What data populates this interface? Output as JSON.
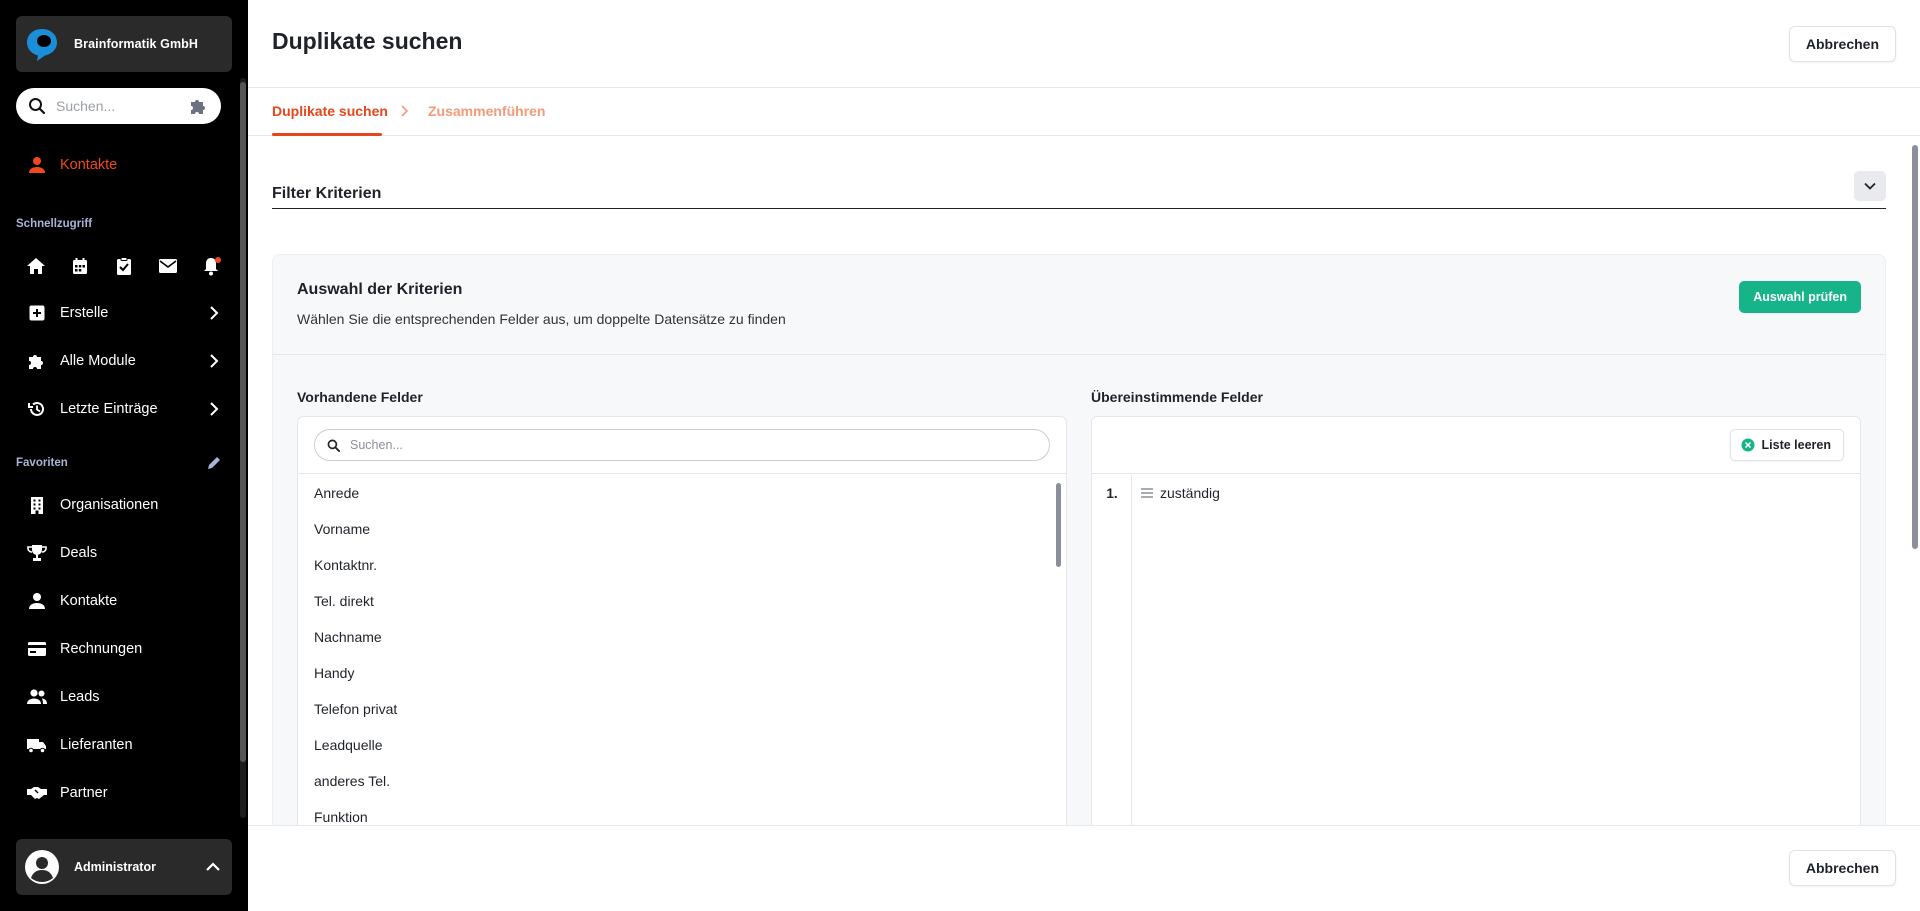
{
  "app": {
    "company": "Brainformatik GmbH",
    "brand_color": "#f04a1c",
    "accent_green": "#17b48a"
  },
  "sidebar": {
    "search_placeholder": "Suchen...",
    "active_item": "Kontakte",
    "quick_access_title": "Schnellzugriff",
    "quick_icons": [
      "home-icon",
      "calendar-icon",
      "clipboard-check-icon",
      "mail-icon",
      "bell-icon"
    ],
    "menus": [
      {
        "label": "Erstelle",
        "icon": "plus-square-icon"
      },
      {
        "label": "Alle Module",
        "icon": "puzzle-icon"
      },
      {
        "label": "Letzte Einträge",
        "icon": "history-icon"
      }
    ],
    "favorites_title": "Favoriten",
    "favorites": [
      {
        "label": "Organisationen",
        "icon": "building-icon"
      },
      {
        "label": "Deals",
        "icon": "trophy-icon"
      },
      {
        "label": "Kontakte",
        "icon": "person-icon"
      },
      {
        "label": "Rechnungen",
        "icon": "credit-card-icon"
      },
      {
        "label": "Leads",
        "icon": "users-icon"
      },
      {
        "label": "Lieferanten",
        "icon": "truck-icon"
      },
      {
        "label": "Partner",
        "icon": "handshake-icon"
      }
    ],
    "user": "Administrator"
  },
  "header": {
    "title": "Duplikate suchen",
    "cancel_label": "Abbrechen"
  },
  "steps": [
    {
      "label": "Duplikate suchen",
      "active": true
    },
    {
      "label": "Zusammenführen",
      "active": false
    }
  ],
  "filter": {
    "title": "Filter Kriterien",
    "panel_title": "Auswahl der Kriterien",
    "panel_subtitle": "Wählen Sie die entsprechenden Felder aus, um doppelte Datensätze zu finden",
    "check_label": "Auswahl prüfen",
    "available_title": "Vorhandene Felder",
    "available_search_placeholder": "Suchen...",
    "available_fields": [
      "Anrede",
      "Vorname",
      "Kontaktnr.",
      "Tel. direkt",
      "Nachname",
      "Handy",
      "Telefon privat",
      "Leadquelle",
      "anderes Tel.",
      "Funktion"
    ],
    "matching_title": "Übereinstimmende Felder",
    "clear_label": "Liste leeren",
    "matching_fields": [
      {
        "num": "1.",
        "label": "zuständig"
      }
    ]
  },
  "footer": {
    "cancel_label": "Abbrechen"
  }
}
